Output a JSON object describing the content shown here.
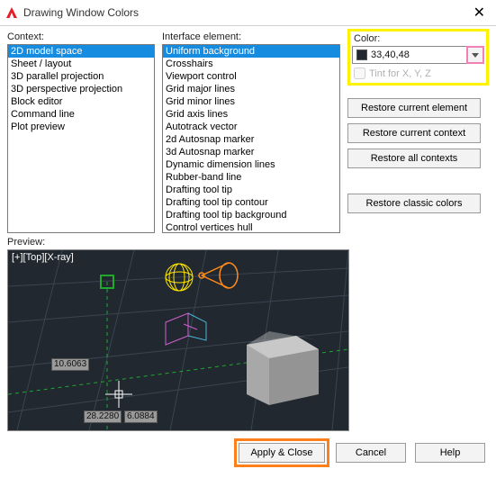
{
  "window": {
    "title": "Drawing Window Colors",
    "close": "✕"
  },
  "context": {
    "label": "Context:",
    "items": [
      "2D model space",
      "Sheet / layout",
      "3D parallel projection",
      "3D perspective projection",
      "Block editor",
      "Command line",
      "Plot preview"
    ],
    "selected": 0
  },
  "interface": {
    "label": "Interface element:",
    "items": [
      "Uniform background",
      "Crosshairs",
      "Viewport control",
      "Grid major lines",
      "Grid minor lines",
      "Grid axis lines",
      "Autotrack vector",
      "2d Autosnap marker",
      "3d Autosnap marker",
      "Dynamic dimension lines",
      "Rubber-band line",
      "Drafting tool tip",
      "Drafting tool tip contour",
      "Drafting tool tip background",
      "Control vertices hull"
    ],
    "selected": 0
  },
  "color": {
    "label": "Color:",
    "value": "33,40,48",
    "swatch": "#212830",
    "tint_label": "Tint for X, Y, Z"
  },
  "buttons": {
    "restore_element": "Restore current element",
    "restore_context": "Restore current context",
    "restore_all": "Restore all contexts",
    "restore_classic": "Restore classic colors",
    "apply_close": "Apply & Close",
    "cancel": "Cancel",
    "help": "Help"
  },
  "preview": {
    "label": "Preview:",
    "top_text": "[+][Top][X-ray]",
    "readout1": "10.6063",
    "readout2a": "28.2280",
    "readout2b": "6.0884"
  }
}
